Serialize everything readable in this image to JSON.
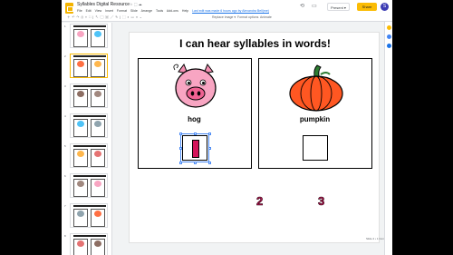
{
  "app": {
    "doc_title": "Syllables Digital Resource",
    "title_icons": "☆ ⬚ ☁",
    "menu": [
      "File",
      "Edit",
      "View",
      "Insert",
      "Format",
      "Slide",
      "Arrange",
      "Tools",
      "Add-ons",
      "Help"
    ],
    "last_edit_note": "Last edit was made 6 hours ago by Alexandra Bell(me)",
    "present_label": "Present ▾",
    "share_label": "Share",
    "avatar_initial": "S",
    "colors": {
      "share": "#fbbc04",
      "avatar": "#3c3cb4",
      "selected_thumb": "#fbbc04"
    }
  },
  "toolbar": {
    "replace_image": "Replace image ▾",
    "format_options": "Format options",
    "animate": "Animate"
  },
  "filmstrip": {
    "slide_numbers": [
      "1",
      "2",
      "3",
      "4",
      "5",
      "6",
      "7",
      "8"
    ],
    "selected_index": 2
  },
  "slide": {
    "title": "I can hear syllables in words!",
    "cards": [
      {
        "word": "hog",
        "answer": "1",
        "picture": "pig-icon"
      },
      {
        "word": "pumpkin",
        "answer": "",
        "picture": "pumpkin-icon"
      }
    ],
    "number_tiles": [
      "2",
      "3"
    ],
    "note": "Slide 2 • 1 Comm"
  }
}
